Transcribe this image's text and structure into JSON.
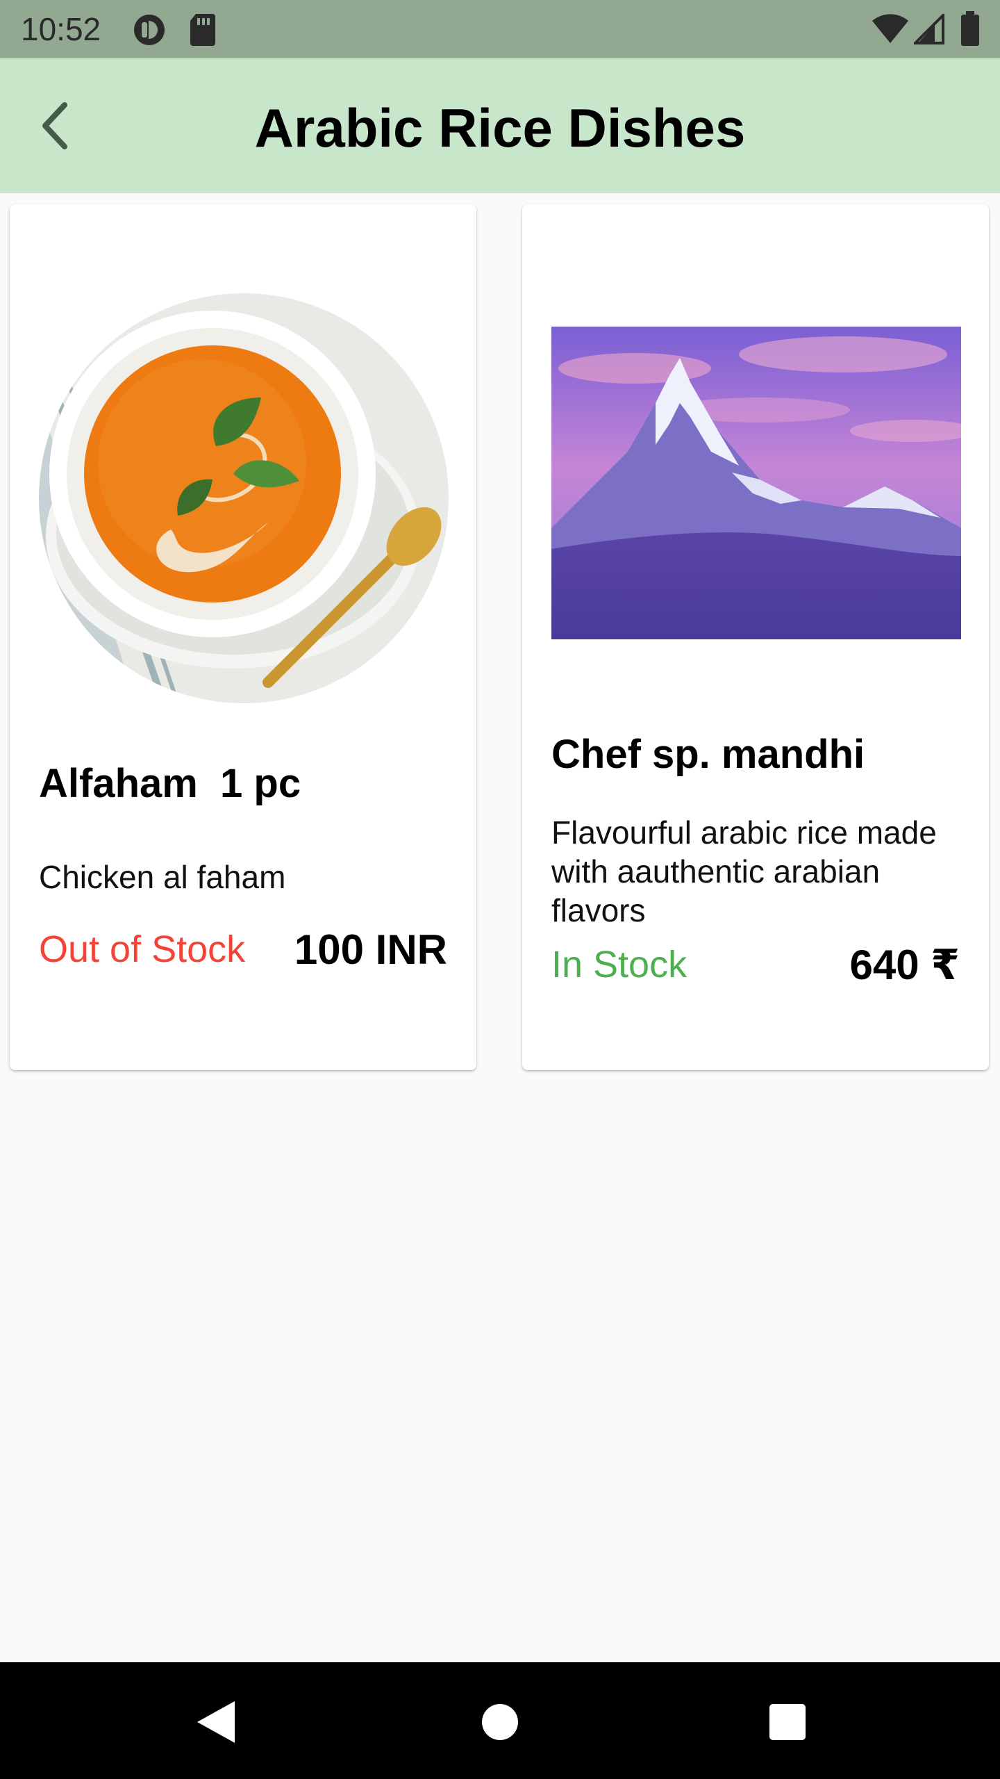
{
  "status_bar": {
    "time": "10:52",
    "icons": [
      "pocket-icon",
      "sd-card-icon",
      "wifi-icon",
      "signal-icon",
      "battery-icon"
    ]
  },
  "app_bar": {
    "title": "Arabic Rice Dishes",
    "back_icon": "arrow-back-icon",
    "background": "#c8e6c9"
  },
  "products": [
    {
      "name": "Alfaham  1 pc",
      "description": "Chicken al faham",
      "stock_status": "Out of Stock",
      "stock_color": "#f44336",
      "price": "100 INR",
      "image": "tomato-soup-bowl-image"
    },
    {
      "name": "Chef sp. mandhi",
      "description": "Flavourful arabic rice made with aauthentic arabian flavors",
      "stock_status": "In Stock",
      "stock_color": "#4caf50",
      "price": "640 ₹",
      "image": "mountain-sunset-image"
    }
  ],
  "nav_bar": {
    "icons": [
      "nav-back-icon",
      "nav-home-icon",
      "nav-recents-icon"
    ]
  }
}
